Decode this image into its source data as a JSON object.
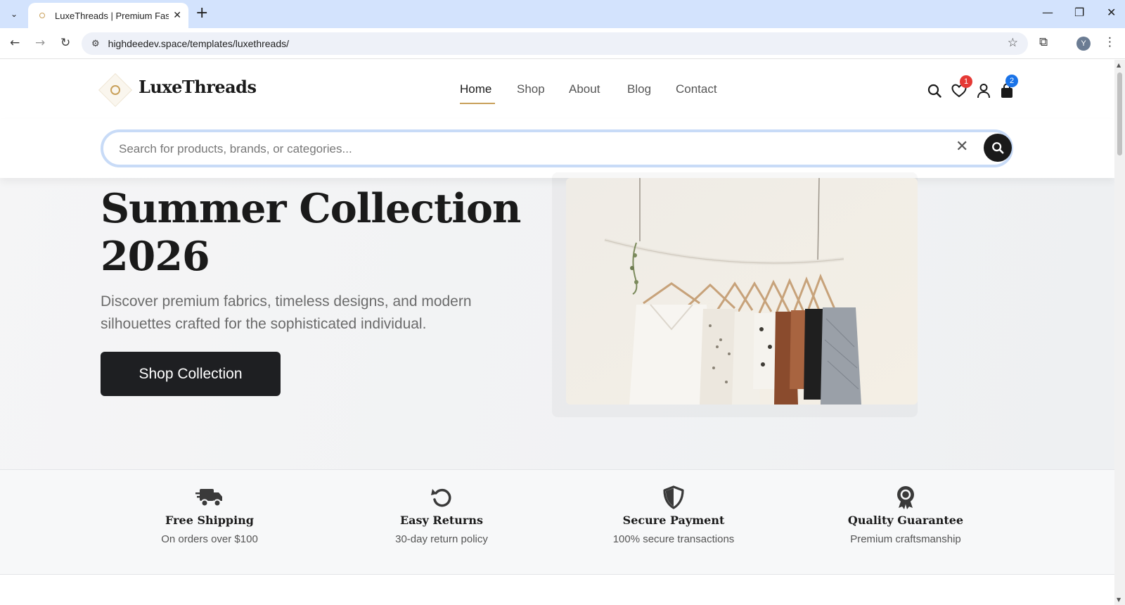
{
  "browser": {
    "tab_title": "LuxeThreads | Premium Fashion",
    "url": "highdeedev.space/templates/luxethreads/",
    "profile_initial": "Y"
  },
  "site": {
    "brand": "LuxeThreads",
    "accent_color": "#c9a15b",
    "nav": [
      {
        "label": "Home",
        "active": true
      },
      {
        "label": "Shop",
        "active": false
      },
      {
        "label": "About",
        "active": false
      },
      {
        "label": "Blog",
        "active": false
      },
      {
        "label": "Contact",
        "active": false
      }
    ],
    "wishlist_count": "1",
    "cart_count": "2",
    "wishlist_badge_color": "#e53935",
    "cart_badge_color": "#1a73e8"
  },
  "search": {
    "placeholder": "Search for products, brands, or categories..."
  },
  "hero": {
    "title": "Summer Collection 2026",
    "subtitle": "Discover premium fabrics, timeless designs, and modern silhouettes crafted for the sophisticated individual.",
    "cta": "Shop Collection"
  },
  "features": [
    {
      "icon": "truck-icon",
      "title": "Free Shipping",
      "desc": "On orders over $100"
    },
    {
      "icon": "undo-icon",
      "title": "Easy Returns",
      "desc": "30-day return policy"
    },
    {
      "icon": "shield-icon",
      "title": "Secure Payment",
      "desc": "100% secure transactions"
    },
    {
      "icon": "award-icon",
      "title": "Quality Guarantee",
      "desc": "Premium craftsmanship"
    }
  ]
}
